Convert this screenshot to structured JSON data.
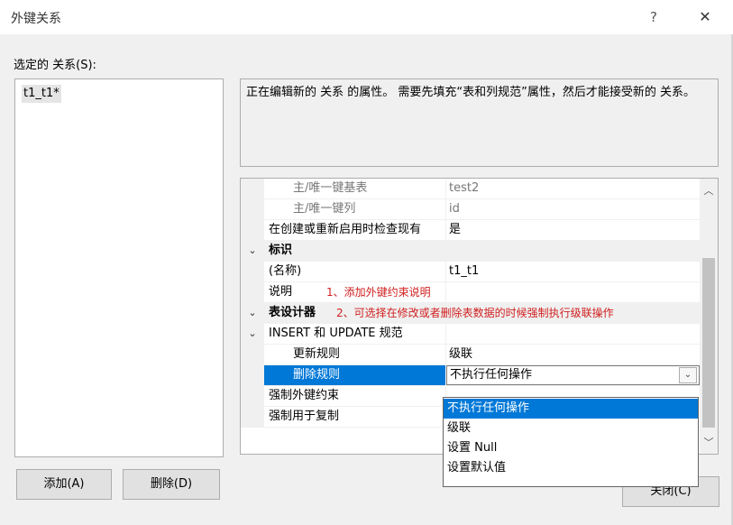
{
  "window": {
    "title": "外键关系",
    "help_glyph": "?",
    "close_glyph": "✕"
  },
  "left": {
    "label": "选定的 关系(S):",
    "relations": [
      "t1_t1*"
    ],
    "add_button": "添加(A)",
    "delete_button": "删除(D)"
  },
  "description": "正在编辑新的 关系 的属性。 需要先填充“表和列规范”属性，然后才能接受新的 关系。",
  "grid": {
    "rows": [
      {
        "name": "主/唯一键基表",
        "value": "test2"
      },
      {
        "name": "主/唯一键列",
        "value": "id"
      },
      {
        "name": "在创建或重新启用时检查现有",
        "value": "是"
      },
      {
        "name": "标识"
      },
      {
        "name": "(名称)",
        "value": "t1_t1"
      },
      {
        "name": "说明",
        "note": "1、添加外键约束说明"
      },
      {
        "name": "表设计器",
        "note": "2、可选择在修改或者删除表数据的时候强制执行级联操作"
      },
      {
        "name": "INSERT 和 UPDATE 规范"
      },
      {
        "name": "更新规则",
        "value": "级联"
      },
      {
        "name": "删除规则",
        "value": "不执行任何操作"
      },
      {
        "name": "强制外键约束"
      },
      {
        "name": "强制用于复制"
      }
    ],
    "toggle_glyph": "⌄",
    "dropdown_glyph": "⌄",
    "scroll_up_glyph": "︿",
    "scroll_down_glyph": "﹀"
  },
  "dropdown_options": [
    "不执行任何操作",
    "级联",
    "设置 Null",
    "设置默认值"
  ],
  "close_button": "关闭(C)",
  "colors": {
    "selection": "#0078d7",
    "annotation": "#d02020"
  }
}
